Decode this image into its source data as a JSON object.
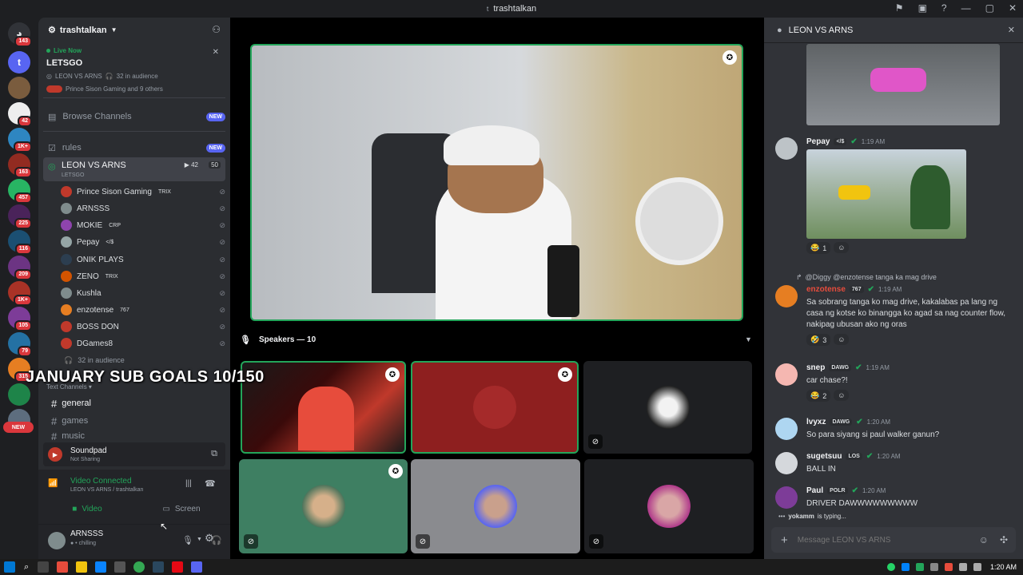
{
  "window": {
    "title": "trashtalkan"
  },
  "rail": {
    "badges": [
      "143",
      "42",
      "1K+",
      "163",
      "457",
      "225",
      "116",
      "209",
      "1K+",
      "105",
      "79",
      "315",
      "NEW"
    ]
  },
  "sidebar": {
    "server_name": "trashtalkan",
    "live": {
      "label": "Live Now",
      "title": "LETSGO",
      "stage_name": "LEON VS ARNS",
      "audience": "32 in audience",
      "participants": "Prince Sison Gaming and 9 others"
    },
    "browse_channels": "Browse Channels",
    "new_label": "NEW",
    "rules": "rules",
    "stage_channel": {
      "name": "LEON VS ARNS",
      "topic": "LETSGO",
      "count1": "42",
      "count2": "50"
    },
    "users": [
      {
        "name": "Prince Sison Gaming",
        "tag": "TRIX",
        "color": "#c0392b"
      },
      {
        "name": "ARNSSS",
        "tag": "",
        "color": "#7f8c8d"
      },
      {
        "name": "MOKIE",
        "tag": "CRP",
        "color": "#8e44ad"
      },
      {
        "name": "Pepay",
        "tag": "</$",
        "color": "#95a5a6"
      },
      {
        "name": "ONIK PLAYS",
        "tag": "",
        "color": "#2c3e50"
      },
      {
        "name": "ZENO",
        "tag": "TRIX",
        "color": "#d35400"
      },
      {
        "name": "Kushla",
        "tag": "",
        "color": "#7f8c8d"
      },
      {
        "name": "enzotense",
        "tag": "767",
        "color": "#e67e22"
      },
      {
        "name": "BOSS DON",
        "tag": "",
        "color": "#c0392b"
      },
      {
        "name": "DGames8",
        "tag": "",
        "color": "#c0392b"
      }
    ],
    "audience_row": "32 in audience",
    "text_channels": "Text Channels",
    "channels": [
      "general",
      "games",
      "music"
    ],
    "soundpad": {
      "title": "Soundpad",
      "status": "Not Sharing"
    },
    "voice": {
      "status": "Video Connected",
      "location": "LEON VS ARNS / trashtalkan"
    },
    "video_btn": "Video",
    "screen_btn": "Screen",
    "me": {
      "name": "ARNSSS",
      "status": "chilling"
    }
  },
  "overlay_text": "JANUARY SUB GOALS 10/150",
  "stage": {
    "speakers_label": "Speakers — 10"
  },
  "chat": {
    "header": "LEON VS ARNS",
    "messages": [
      {
        "author": "Pepay",
        "tag": "</$",
        "time": "1:19 AM",
        "text": "",
        "reaction": "1",
        "color": "#bdc3c7"
      },
      {
        "reply": "@Diggy @enzotense tanga ka mag drive",
        "author": "enzotense",
        "tag": "767",
        "time": "1:19 AM",
        "text": "Sa sobrang tanga ko mag drive, kakalabas pa lang ng casa ng kotse ko binangga ko agad sa nag counter flow, nakipag ubusan ako ng oras",
        "reaction": "3",
        "color": "#e67e22"
      },
      {
        "author": "snep",
        "tag": "DAWG",
        "time": "1:19 AM",
        "text": "car chase?!",
        "reaction": "2",
        "color": "#f5b7b1"
      },
      {
        "author": "lvyxz",
        "tag": "DAWG",
        "time": "1:20 AM",
        "text": "So para siyang si paul walker ganun?",
        "reaction": "",
        "color": "#aed6f1"
      },
      {
        "author": "sugetsuu",
        "tag": "LOS",
        "time": "1:20 AM",
        "text": "BALL IN",
        "reaction": "",
        "color": "#d5d8dc"
      },
      {
        "author": "Paul",
        "tag": "POLR",
        "time": "1:20 AM",
        "text": "DRIVER DAWWWWWWWWW",
        "reaction": "",
        "color": "#7d3c98"
      }
    ],
    "typing_user": "yokamm",
    "typing_suffix": "is typing...",
    "input_placeholder": "Message LEON VS ARNS"
  },
  "taskbar": {
    "time": "1:20 AM"
  }
}
